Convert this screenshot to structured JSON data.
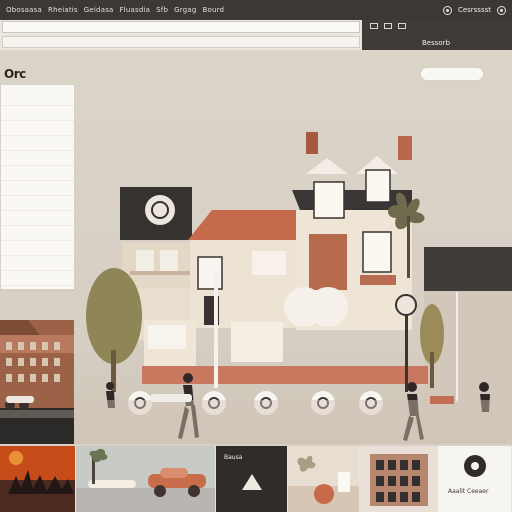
{
  "top_tabs": [
    "Obosaasa",
    "Rheiatis",
    "Geidasa",
    "Fluasdia",
    "Sfb",
    "Grgag",
    "Bourd"
  ],
  "top_right": {
    "label": "Cesrsssst"
  },
  "address": {
    "primary_text": "",
    "secondary_text": ""
  },
  "address_side": {
    "label": "Bessorb"
  },
  "canvas": {
    "logo": "Orc",
    "top_action": ""
  },
  "sidebar": {
    "items": [
      "",
      "",
      "",
      "",
      "",
      "",
      "",
      "",
      "",
      "",
      "",
      "",
      ""
    ]
  },
  "cards": [
    {
      "label": ""
    },
    {
      "label": ""
    },
    {
      "label": "Bausa"
    },
    {
      "label": ""
    },
    {
      "label": ""
    },
    {
      "label": "Aaalit Ceeaer"
    }
  ],
  "colors": {
    "top_bar": "#3b3836",
    "accent_orange": "#c04d1e",
    "house_cream": "#ece3d4",
    "roof_brick": "#c56a4b",
    "dark_roof": "#3f3c39"
  }
}
